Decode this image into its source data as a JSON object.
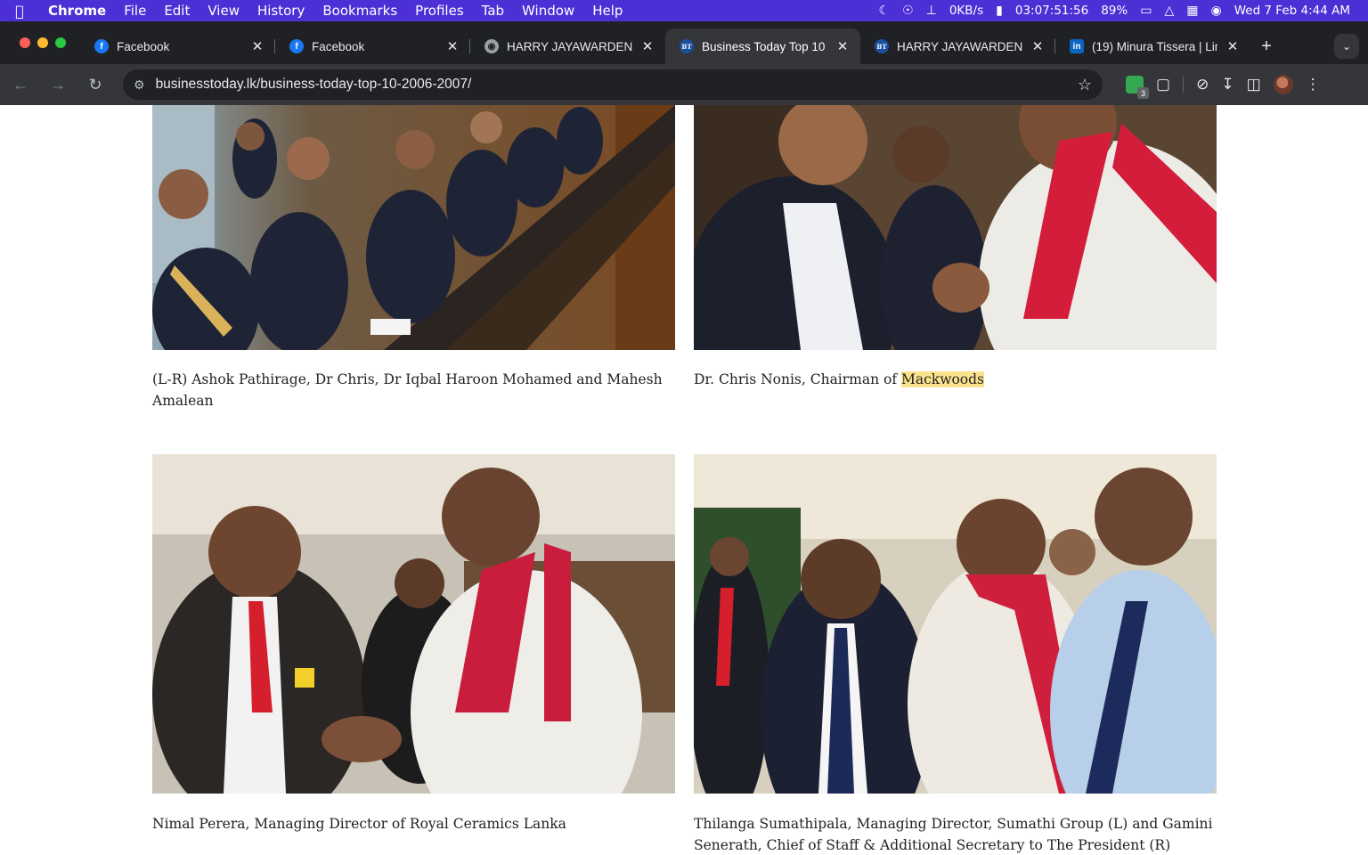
{
  "menubar": {
    "app": "Chrome",
    "items": [
      "File",
      "Edit",
      "View",
      "History",
      "Bookmarks",
      "Profiles",
      "Tab",
      "Window",
      "Help"
    ],
    "net_speed": "0KB/s",
    "timer": "03:07:51:56",
    "battery": "89%",
    "datetime": "Wed 7 Feb  4:44 AM",
    "icons": [
      "apple-icon",
      "moon-icon",
      "vpn-icon",
      "clip-icon",
      "battery-icon",
      "wifi-icon",
      "control-center-icon",
      "siri-icon"
    ]
  },
  "tabs": [
    {
      "title": "Facebook",
      "favicon": "facebook-icon",
      "active": false
    },
    {
      "title": "Facebook",
      "favicon": "facebook-icon",
      "active": false
    },
    {
      "title": "HARRY JAYAWARDENE",
      "favicon": "globe-icon",
      "active": false
    },
    {
      "title": "Business Today Top 10",
      "favicon": "bt-icon",
      "active": true
    },
    {
      "title": "HARRY JAYAWARDENA",
      "favicon": "bt-icon",
      "active": false
    },
    {
      "title": "(19) Minura Tissera | Lin",
      "favicon": "linkedin-icon",
      "active": false
    }
  ],
  "toolbar": {
    "url": "businesstoday.lk/business-today-top-10-2006-2007/",
    "extension_badge": "3"
  },
  "content": {
    "captions": [
      {
        "text": "(L-R) Ashok Pathirage, Dr Chris, Dr Iqbal Haroon Mohamed and Mahesh Amalean"
      },
      {
        "prefix": "Dr. Chris Nonis, Chairman of ",
        "highlight": "Mackwoods"
      },
      {
        "text": "Nimal Perera, Managing Director of Royal Ceramics Lanka"
      },
      {
        "text": "Thilanga Sumathipala, Managing Director, Sumathi Group (L) and Gamini Senerath, Chief of Staff & Additional Secretary to The President (R)"
      }
    ]
  },
  "colors": {
    "menubar": "#4d2fd6",
    "tabstrip": "#202124",
    "toolbar": "#35363a",
    "highlight": "#fbe38e"
  }
}
